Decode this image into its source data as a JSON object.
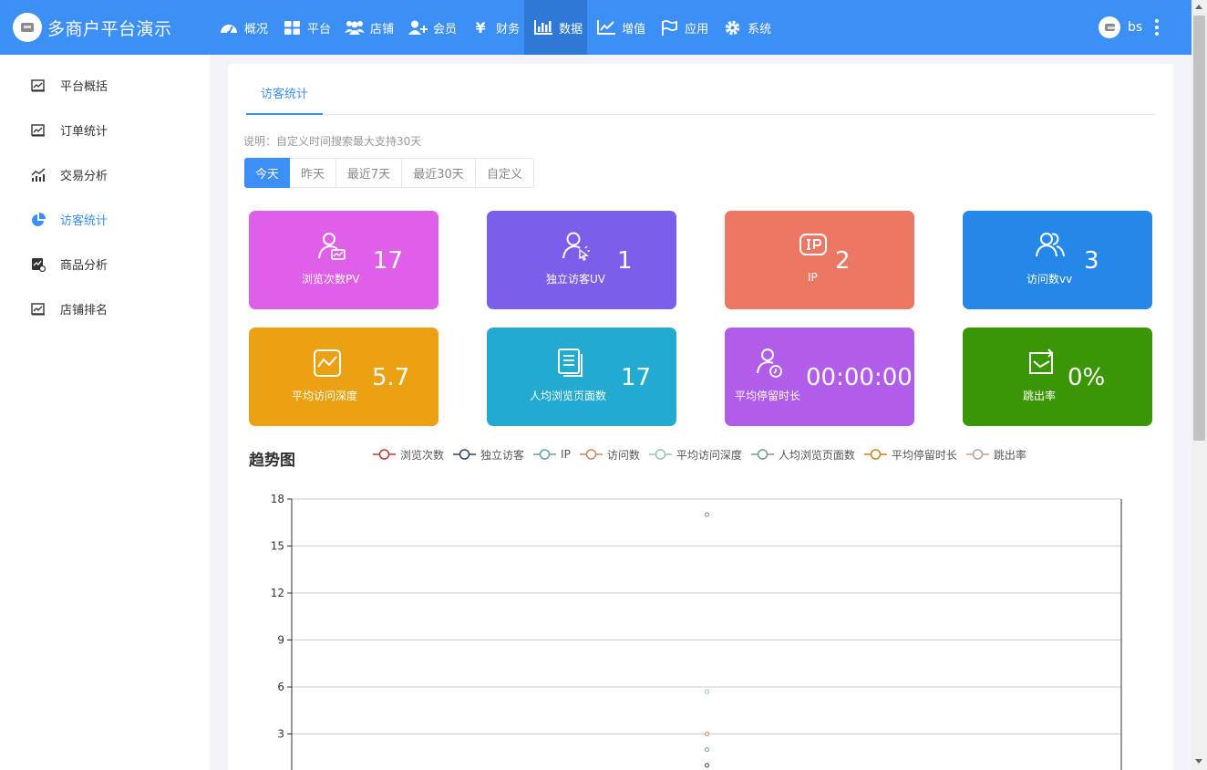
{
  "header": {
    "brand": "多商户平台演示",
    "nav": [
      {
        "label": "概况",
        "icon": "dashboard-icon"
      },
      {
        "label": "平台",
        "icon": "grid-icon"
      },
      {
        "label": "店铺",
        "icon": "users-icon"
      },
      {
        "label": "会员",
        "icon": "user-plus-icon"
      },
      {
        "label": "财务",
        "icon": "yen-icon"
      },
      {
        "label": "数据",
        "icon": "bar-chart-icon",
        "active": true
      },
      {
        "label": "增值",
        "icon": "line-chart-icon"
      },
      {
        "label": "应用",
        "icon": "flag-icon"
      },
      {
        "label": "系统",
        "icon": "gear-icon"
      }
    ],
    "user": "bs"
  },
  "sidebar": {
    "items": [
      {
        "label": "平台概括",
        "icon": "line-chart-icon"
      },
      {
        "label": "订单统计",
        "icon": "line-chart-icon"
      },
      {
        "label": "交易分析",
        "icon": "bar-trend-icon"
      },
      {
        "label": "访客统计",
        "icon": "pie-chart-icon",
        "active": true
      },
      {
        "label": "商品分析",
        "icon": "product-chart-icon"
      },
      {
        "label": "店铺排名",
        "icon": "line-chart-icon"
      }
    ]
  },
  "main": {
    "tab": "访客统计",
    "note": "说明：自定义时间搜索最大支持30天",
    "ranges": [
      "今天",
      "昨天",
      "最近7天",
      "最近30天",
      "自定义"
    ],
    "active_range": "今天",
    "cards": [
      {
        "label": "浏览次数PV",
        "value": "17",
        "color": "#df5fe9",
        "icon": "page-view-icon"
      },
      {
        "label": "独立访客UV",
        "value": "1",
        "color": "#7b5ee9",
        "icon": "visitor-click-icon"
      },
      {
        "label": "IP",
        "value": "2",
        "color": "#ec7762",
        "icon": "ip-icon"
      },
      {
        "label": "访问数vv",
        "value": "3",
        "color": "#2587e8",
        "icon": "users-icon"
      },
      {
        "label": "平均访问深度",
        "value": "5.7",
        "color": "#eba111",
        "icon": "depth-chart-icon"
      },
      {
        "label": "人均浏览页面数",
        "value": "17",
        "color": "#23aad0",
        "icon": "pages-icon"
      },
      {
        "label": "平均停留时长",
        "value": "00:00:00",
        "color": "#b15de9",
        "icon": "user-clock-icon"
      },
      {
        "label": "跳出率",
        "value": "0%",
        "color": "#3a9703",
        "icon": "bounce-icon"
      }
    ],
    "chart_title": "趋势图"
  },
  "chart_data": {
    "type": "line",
    "series": [
      {
        "name": "浏览次数",
        "color": "#c23531",
        "value": 17
      },
      {
        "name": "独立访客",
        "color": "#2f4554",
        "value": 1
      },
      {
        "name": "IP",
        "color": "#61a0a8",
        "value": 2
      },
      {
        "name": "访问数",
        "color": "#d48265",
        "value": 3
      },
      {
        "name": "平均访问深度",
        "color": "#91c7ae",
        "value": 5.7
      },
      {
        "name": "人均浏览页面数",
        "color": "#749f83",
        "value": 17
      },
      {
        "name": "平均停留时长",
        "color": "#ca8622",
        "value": 0
      },
      {
        "name": "跳出率",
        "color": "#bda29a",
        "value": 0
      }
    ],
    "yticks": [
      "18",
      "15",
      "12",
      "9",
      "6",
      "3"
    ],
    "ylim": [
      0,
      18
    ],
    "grid": true
  }
}
